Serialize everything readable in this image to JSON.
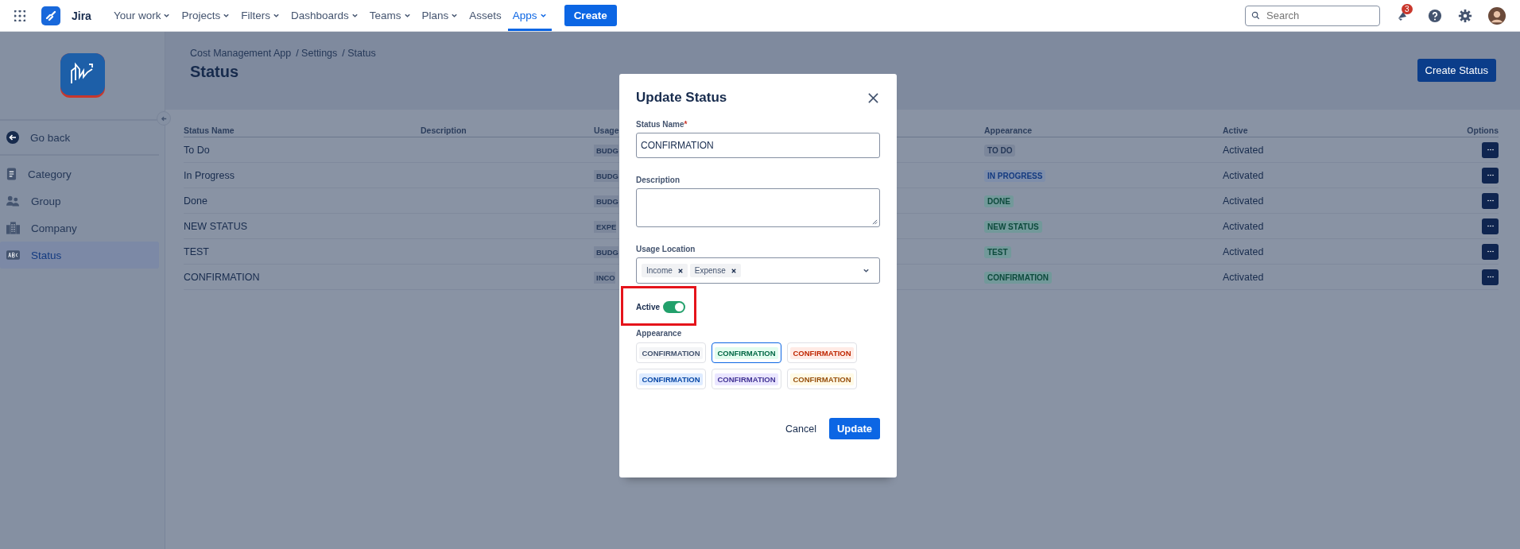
{
  "topbar": {
    "product": "Jira",
    "nav": [
      {
        "label": "Your work",
        "dropdown": true,
        "selected": false
      },
      {
        "label": "Projects",
        "dropdown": true,
        "selected": false
      },
      {
        "label": "Filters",
        "dropdown": true,
        "selected": false
      },
      {
        "label": "Dashboards",
        "dropdown": true,
        "selected": false
      },
      {
        "label": "Teams",
        "dropdown": true,
        "selected": false
      },
      {
        "label": "Plans",
        "dropdown": true,
        "selected": false
      },
      {
        "label": "Assets",
        "dropdown": false,
        "selected": false
      },
      {
        "label": "Apps",
        "dropdown": true,
        "selected": true
      }
    ],
    "create_button": "Create",
    "search": {
      "placeholder": "Search"
    },
    "notification_count": "3"
  },
  "sidebar": {
    "back": "Go back",
    "items": [
      {
        "label": "Category",
        "selected": false
      },
      {
        "label": "Group",
        "selected": false
      },
      {
        "label": "Company",
        "selected": false
      },
      {
        "label": "Status",
        "selected": true
      }
    ]
  },
  "breadcrumbs": [
    "Cost Management App",
    "/ Settings",
    "/ Status"
  ],
  "page_title": "Status",
  "create_status_button": "Create Status",
  "table": {
    "columns": [
      "Status Name",
      "Description",
      "Usage",
      "Appearance",
      "Active",
      "Options"
    ],
    "rows": [
      {
        "name": "To Do",
        "usage": "BUDG",
        "appearance": "TO DO",
        "color": "#7c879b",
        "active": "Activated"
      },
      {
        "name": "In Progress",
        "usage": "BUDG",
        "appearance": "IN PROGRESS",
        "color": "#7e8eaa",
        "active": "Activated"
      },
      {
        "name": "Done",
        "usage": "BUDG",
        "appearance": "DONE",
        "color": "#72999a",
        "active": "Activated"
      },
      {
        "name": "NEW STATUS",
        "usage": "EXPE",
        "appearance": "NEW STATUS",
        "color": "#72999a",
        "active": "Activated"
      },
      {
        "name": "TEST",
        "usage": "BUDG",
        "appearance": "TEST",
        "color": "#72999a",
        "active": "Activated"
      },
      {
        "name": "CONFIRMATION",
        "usage": "INCO",
        "appearance": "CONFIRMATION",
        "color": "#72999a",
        "active": "Activated"
      }
    ]
  },
  "modal": {
    "title": "Update Status",
    "status_name": {
      "label": "Status Name",
      "required_mark": "*",
      "value": "CONFIRMATION"
    },
    "description": {
      "label": "Description"
    },
    "usage_location": {
      "label": "Usage Location",
      "tags": [
        "Income",
        "Expense"
      ]
    },
    "active": {
      "label": "Active",
      "on": true,
      "highlighted": true
    },
    "appearance": {
      "label": "Appearance",
      "options": [
        {
          "text": "CONFIRMATION",
          "color": "#42526e",
          "selected": false
        },
        {
          "text": "CONFIRMATION",
          "color": "#006644",
          "selected": true
        },
        {
          "text": "CONFIRMATION",
          "color": "#bf2600",
          "selected": false
        },
        {
          "text": "CONFIRMATION",
          "color": "#0747a6",
          "selected": false
        },
        {
          "text": "CONFIRMATION",
          "color": "#403294",
          "selected": false
        },
        {
          "text": "CONFIRMATION",
          "color": "#974f0c",
          "selected": false
        }
      ]
    },
    "cancel": "Cancel",
    "submit": "Update"
  }
}
